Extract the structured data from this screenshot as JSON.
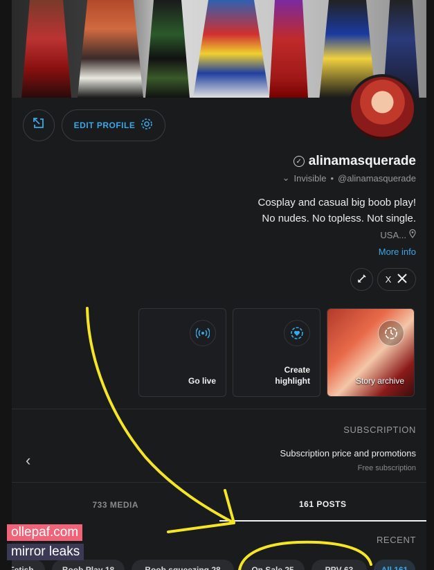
{
  "banner": {
    "alt": "cosplay banner"
  },
  "profile": {
    "name": "alinamasquerade",
    "verified_glyph": "✓",
    "handle": "@alinamasquerade",
    "separator": "•",
    "status": "Invisible",
    "status_caret": "⌄",
    "bio_line1": "Cosplay and casual big boob play!",
    "bio_line2": "No nudes. No topless. Not single.",
    "location": "USA...",
    "location_icon": "pin-icon",
    "more_info": "More info"
  },
  "actions": {
    "share_icon": "share-icon",
    "edit_profile": "EDIT PROFILE",
    "edit_icon": "gear-icon"
  },
  "social": {
    "x_label": "X",
    "x_icon": "x-logo-icon",
    "edit_icon": "pencil-icon"
  },
  "highlights": [
    {
      "label_line1": "Go live",
      "label_line2": "",
      "icon": "broadcast-icon"
    },
    {
      "label_line1": "Create",
      "label_line2": "highlight",
      "icon": "heart-badge-icon"
    },
    {
      "label_line1": "Story archive",
      "label_line2": "",
      "icon": "clock-icon"
    }
  ],
  "subscription": {
    "heading": "SUBSCRIPTION",
    "title": "Subscription price and promotions",
    "subtitle": "Free subscription",
    "chevron": "‹"
  },
  "tabs": [
    {
      "label": "161 POSTS",
      "active": true
    },
    {
      "label": "733 MEDIA",
      "active": false
    }
  ],
  "recent": "RECENT",
  "chips": [
    {
      "label": "All 161",
      "active": true
    },
    {
      "label": "PPV 63",
      "active": false
    },
    {
      "label": "On Sale 25",
      "active": false
    },
    {
      "label": "Boob squeezing 28",
      "active": false
    },
    {
      "label": "Boob Play 18",
      "active": false
    },
    {
      "label": "Fetish",
      "active": false
    }
  ],
  "watermark": {
    "line1": "ollepaf.com",
    "line2": "mirror leaks"
  },
  "colors": {
    "accent": "#39a8e8",
    "background": "#1a1b1d",
    "annotation": "#f5e625"
  }
}
